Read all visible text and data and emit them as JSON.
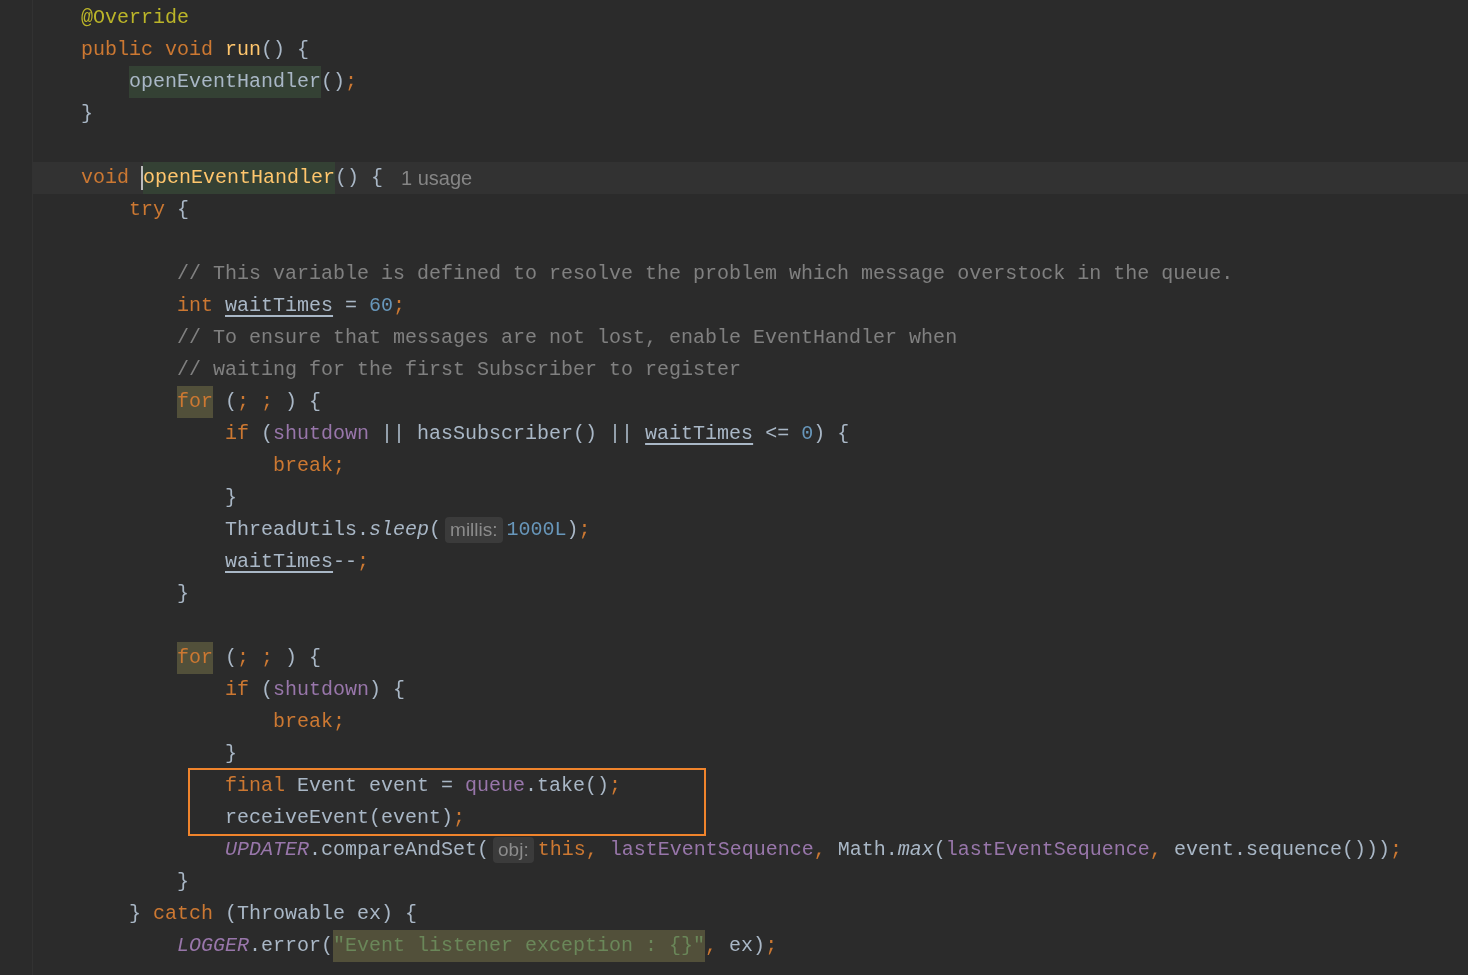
{
  "editor": {
    "lines": [
      {
        "kind": "code",
        "tokens": [
          {
            "kind": "annotation",
            "text": "@Override"
          }
        ]
      },
      {
        "kind": "code",
        "tokens": [
          {
            "kind": "keyword",
            "text": "public void "
          },
          {
            "kind": "declaration",
            "text": "run"
          },
          {
            "kind": "plain",
            "text": "() {"
          }
        ],
        "children": [
          {
            "kind": "code",
            "tokens": [
              {
                "kind": "plain",
                "text": "openEventHandler",
                "highlighted": true
              },
              {
                "kind": "plain",
                "text": "()"
              },
              {
                "kind": "keyword",
                "text": ";"
              }
            ]
          }
        ]
      },
      {
        "kind": "code",
        "tokens": [
          {
            "kind": "plain",
            "text": "}"
          }
        ]
      },
      {
        "kind": "blank"
      },
      {
        "kind": "code",
        "current": true,
        "tokens": [
          {
            "kind": "keyword",
            "text": "void "
          },
          {
            "kind": "declaration",
            "text": "openEventHandler",
            "highlighted": true,
            "caret": true
          },
          {
            "kind": "plain",
            "text": "() {"
          },
          {
            "kind": "usage",
            "text": "1 usage"
          }
        ],
        "children": [
          {
            "kind": "code",
            "tokens": [
              {
                "kind": "keyword",
                "text": "try "
              },
              {
                "kind": "plain",
                "text": "{"
              }
            ],
            "children": [
              {
                "kind": "blank"
              },
              {
                "kind": "code",
                "tokens": [
                  {
                    "kind": "comment",
                    "text": "// This variable is defined to resolve the problem which message overstock in the queue."
                  }
                ]
              },
              {
                "kind": "code",
                "tokens": [
                  {
                    "kind": "keyword",
                    "text": "int "
                  },
                  {
                    "kind": "plain",
                    "text": "waitTimes",
                    "underline": true
                  },
                  {
                    "kind": "plain",
                    "text": " = "
                  },
                  {
                    "kind": "number",
                    "text": "60"
                  },
                  {
                    "kind": "keyword",
                    "text": ";"
                  }
                ]
              },
              {
                "kind": "code",
                "tokens": [
                  {
                    "kind": "comment",
                    "text": "// To ensure that messages are not lost, enable EventHandler when"
                  }
                ]
              },
              {
                "kind": "code",
                "tokens": [
                  {
                    "kind": "comment",
                    "text": "// waiting for the first Subscriber to register"
                  }
                ]
              },
              {
                "kind": "code",
                "tokens": [
                  {
                    "kind": "keyword",
                    "text": "for",
                    "highlighted": true
                  },
                  {
                    "kind": "plain",
                    "text": " ("
                  },
                  {
                    "kind": "keyword",
                    "text": "; ; "
                  },
                  {
                    "kind": "plain",
                    "text": ") {"
                  }
                ],
                "children": [
                  {
                    "kind": "code",
                    "tokens": [
                      {
                        "kind": "keyword",
                        "text": "if "
                      },
                      {
                        "kind": "plain",
                        "text": "("
                      },
                      {
                        "kind": "field",
                        "text": "shutdown"
                      },
                      {
                        "kind": "plain",
                        "text": " || hasSubscriber() || "
                      },
                      {
                        "kind": "plain",
                        "text": "waitTimes",
                        "underline": true
                      },
                      {
                        "kind": "plain",
                        "text": " <= "
                      },
                      {
                        "kind": "number",
                        "text": "0"
                      },
                      {
                        "kind": "plain",
                        "text": ") {"
                      }
                    ],
                    "children": [
                      {
                        "kind": "code",
                        "tokens": [
                          {
                            "kind": "keyword",
                            "text": "break;"
                          }
                        ]
                      }
                    ]
                  },
                  {
                    "kind": "code",
                    "tokens": [
                      {
                        "kind": "plain",
                        "text": "}"
                      }
                    ]
                  },
                  {
                    "kind": "code",
                    "tokens": [
                      {
                        "kind": "plain",
                        "text": "ThreadUtils."
                      },
                      {
                        "kind": "static",
                        "text": "sleep"
                      },
                      {
                        "kind": "plain",
                        "text": "("
                      },
                      {
                        "kind": "hint",
                        "text": "millis:"
                      },
                      {
                        "kind": "number",
                        "text": "1000L"
                      },
                      {
                        "kind": "plain",
                        "text": ")"
                      },
                      {
                        "kind": "keyword",
                        "text": ";"
                      }
                    ]
                  },
                  {
                    "kind": "code",
                    "tokens": [
                      {
                        "kind": "plain",
                        "text": "waitTimes",
                        "underline": true
                      },
                      {
                        "kind": "plain",
                        "text": "--"
                      },
                      {
                        "kind": "keyword",
                        "text": ";"
                      }
                    ]
                  }
                ]
              },
              {
                "kind": "code",
                "tokens": [
                  {
                    "kind": "plain",
                    "text": "}"
                  }
                ]
              },
              {
                "kind": "blank"
              },
              {
                "kind": "code",
                "tokens": [
                  {
                    "kind": "keyword",
                    "text": "for",
                    "highlighted": true
                  },
                  {
                    "kind": "plain",
                    "text": " ("
                  },
                  {
                    "kind": "keyword",
                    "text": "; ; "
                  },
                  {
                    "kind": "plain",
                    "text": ") {"
                  }
                ],
                "children": [
                  {
                    "kind": "code",
                    "tokens": [
                      {
                        "kind": "keyword",
                        "text": "if "
                      },
                      {
                        "kind": "plain",
                        "text": "("
                      },
                      {
                        "kind": "field",
                        "text": "shutdown"
                      },
                      {
                        "kind": "plain",
                        "text": ") {"
                      }
                    ],
                    "children": [
                      {
                        "kind": "code",
                        "tokens": [
                          {
                            "kind": "keyword",
                            "text": "break;"
                          }
                        ]
                      }
                    ]
                  },
                  {
                    "kind": "code",
                    "tokens": [
                      {
                        "kind": "plain",
                        "text": "}"
                      }
                    ]
                  },
                  {
                    "kind": "code",
                    "boxed": true,
                    "tokens": [
                      {
                        "kind": "keyword",
                        "text": "final "
                      },
                      {
                        "kind": "plain",
                        "text": "Event event = "
                      },
                      {
                        "kind": "field",
                        "text": "queue"
                      },
                      {
                        "kind": "plain",
                        "text": ".take()"
                      },
                      {
                        "kind": "keyword",
                        "text": ";"
                      }
                    ]
                  },
                  {
                    "kind": "code",
                    "boxed": true,
                    "tokens": [
                      {
                        "kind": "plain",
                        "text": "receiveEvent(event)"
                      },
                      {
                        "kind": "keyword",
                        "text": ";"
                      }
                    ]
                  },
                  {
                    "kind": "code",
                    "tokens": [
                      {
                        "kind": "static-field",
                        "text": "UPDATER"
                      },
                      {
                        "kind": "plain",
                        "text": ".compareAndSet("
                      },
                      {
                        "kind": "hint",
                        "text": "obj:"
                      },
                      {
                        "kind": "keyword",
                        "text": "this, "
                      },
                      {
                        "kind": "field",
                        "text": "lastEventSequence"
                      },
                      {
                        "kind": "keyword",
                        "text": ", "
                      },
                      {
                        "kind": "plain",
                        "text": "Math."
                      },
                      {
                        "kind": "static",
                        "text": "max"
                      },
                      {
                        "kind": "plain",
                        "text": "("
                      },
                      {
                        "kind": "field",
                        "text": "lastEventSequence"
                      },
                      {
                        "kind": "keyword",
                        "text": ", "
                      },
                      {
                        "kind": "plain",
                        "text": "event.sequence()))"
                      },
                      {
                        "kind": "keyword",
                        "text": ";"
                      }
                    ]
                  }
                ]
              },
              {
                "kind": "code",
                "tokens": [
                  {
                    "kind": "plain",
                    "text": "}"
                  }
                ]
              }
            ]
          },
          {
            "kind": "code",
            "tokens": [
              {
                "kind": "plain",
                "text": "} "
              },
              {
                "kind": "keyword",
                "text": "catch "
              },
              {
                "kind": "plain",
                "text": "(Throwable ex) {"
              }
            ],
            "children": [
              {
                "kind": "code",
                "tokens": [
                  {
                    "kind": "static-field",
                    "text": "LOGGER"
                  },
                  {
                    "kind": "plain",
                    "text": ".error("
                  },
                  {
                    "kind": "string",
                    "text": "\"Event listener exception : {}\"",
                    "highlighted": true
                  },
                  {
                    "kind": "keyword",
                    "text": ", "
                  },
                  {
                    "kind": "plain",
                    "text": "ex)"
                  },
                  {
                    "kind": "keyword",
                    "text": ";"
                  }
                ]
              }
            ]
          }
        ]
      }
    ]
  }
}
